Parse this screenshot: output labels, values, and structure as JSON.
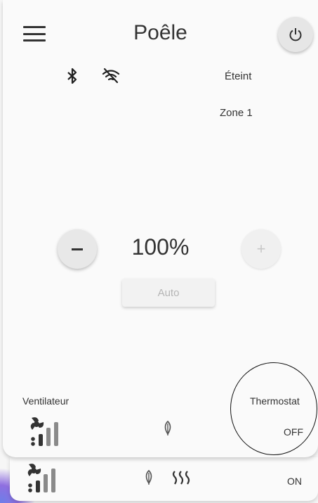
{
  "header": {
    "title": "Poêle",
    "menu_icon": "hamburger-icon",
    "power_icon": "power-icon"
  },
  "status": {
    "bluetooth_icon": "bluetooth-icon",
    "wifi_icon": "wifi-off-icon",
    "state": "Éteint",
    "zone": "Zone 1"
  },
  "control": {
    "minus_icon": "minus-icon",
    "plus_label": "+",
    "power_percent": "100%",
    "mode_label": "Auto"
  },
  "bottom_panel": {
    "fan_label": "Ventilateur",
    "thermostat_label": "Thermostat",
    "thermostat_value": "OFF",
    "fan_icon": "fan-level-icon",
    "eco_icon": "leaf-icon"
  },
  "second_panel": {
    "fan_icon": "fan-level-icon",
    "eco_icon": "leaf-icon",
    "heat_icon": "heat-waves-icon",
    "status_value": "ON"
  },
  "colors": {
    "background": "#f6f6f6",
    "card": "#fafafa",
    "text": "#333333",
    "disabled": "#b5b5b5"
  }
}
